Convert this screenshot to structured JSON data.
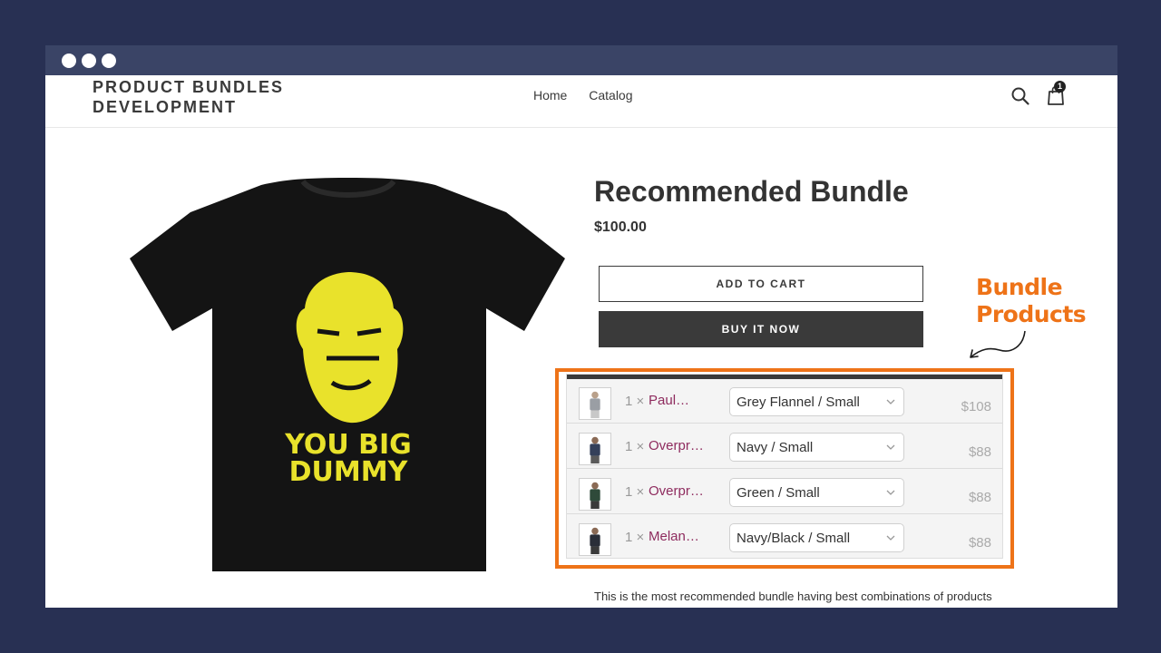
{
  "window": {
    "dots": 3
  },
  "store": {
    "logo_line1": "PRODUCT BUNDLES",
    "logo_line2": "DEVELOPMENT",
    "nav": [
      "Home",
      "Catalog"
    ],
    "cart_count": "1"
  },
  "product": {
    "image_text_line1": "YOU BIG",
    "image_text_line2": "DUMMY",
    "title": "Recommended Bundle",
    "price": "$100.00",
    "add_to_cart": "ADD TO CART",
    "buy_now": "BUY IT NOW",
    "description": "This is the most recommended bundle having best combinations of products"
  },
  "annotation": {
    "line1": "Bundle",
    "line2": "Products",
    "color": "#ee7318"
  },
  "bundle": {
    "items": [
      {
        "qty": "1 ×",
        "name": "Paul…",
        "variant": "Grey Flannel / Small",
        "price": "$108"
      },
      {
        "qty": "1 ×",
        "name": "Overpr…",
        "variant": "Navy / Small",
        "price": "$88"
      },
      {
        "qty": "1 ×",
        "name": "Overpr…",
        "variant": "Green / Small",
        "price": "$88"
      },
      {
        "qty": "1 ×",
        "name": "Melan…",
        "variant": "Navy/Black / Small",
        "price": "$88"
      }
    ]
  }
}
